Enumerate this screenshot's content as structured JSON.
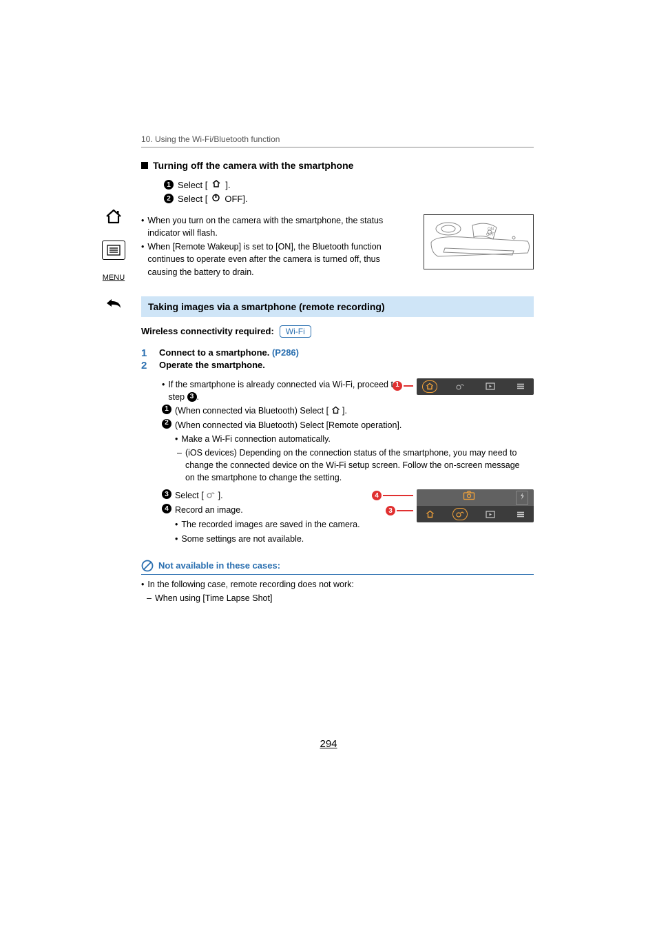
{
  "sidebar": {
    "menu_label": "MENU"
  },
  "chapter": "10. Using the Wi-Fi/Bluetooth function",
  "turn_off": {
    "heading": "Turning off the camera with the smartphone",
    "step1_a": "Select [",
    "step1_b": "].",
    "step2_a": "Select [",
    "step2_b": "OFF]."
  },
  "info": {
    "b1": "When you turn on the camera with the smartphone, the status indicator will flash.",
    "b2": "When [Remote Wakeup] is set to [ON], the Bluetooth function continues to operate even after the camera is turned off, thus causing the battery to drain."
  },
  "section_title": "Taking images via a smartphone (remote recording)",
  "conn_req_label": "Wireless connectivity required:",
  "conn_req_tag": "Wi-Fi",
  "mainsteps": {
    "s1": {
      "num": "1",
      "text_a": "Connect to a smartphone. ",
      "link": "(P286)"
    },
    "s2": {
      "num": "2",
      "text": "Operate the smartphone."
    }
  },
  "sub": {
    "intro_a": "If the smartphone is already connected via Wi-Fi, proceed to step ",
    "intro_b": ".",
    "n1_a": "(When connected via Bluetooth) Select [",
    "n1_b": "].",
    "n2": "(When connected via Bluetooth) Select [Remote operation].",
    "n2_sub": "Make a Wi-Fi connection automatically.",
    "n2_sub2": "(iOS devices) Depending on the connection status of the smartphone, you may need to change the connected device on the Wi-Fi setup screen. Follow the on-screen message on the smartphone to change the setting.",
    "n3_a": "Select [",
    "n3_b": "].",
    "n4": "Record an image.",
    "n4_sub1": "The recorded images are saved in the camera.",
    "n4_sub2": "Some settings are not available."
  },
  "na": {
    "heading": "Not available in these cases:",
    "line1": "In the following case, remote recording does not work:",
    "line2": "When using [Time Lapse Shot]"
  },
  "page_number": "294",
  "callouts": {
    "c1": "1",
    "c3": "3",
    "c4": "4"
  }
}
